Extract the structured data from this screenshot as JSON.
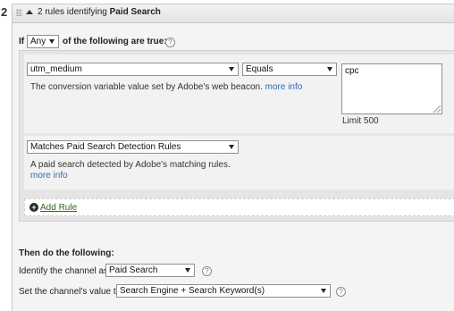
{
  "rule": {
    "number": "2",
    "title_prefix": "2 rules identifying ",
    "title_bold": "Paid Search"
  },
  "conditions": {
    "if_label": "If",
    "match_select": "Any",
    "of_following": "of the following are true:"
  },
  "rules": [
    {
      "variable_select": "utm_medium",
      "operator_select": "Equals",
      "value_text": "cpc",
      "limit_text": "Limit 500",
      "description": "The conversion variable value set by Adobe's web beacon.",
      "more_info": "more info"
    },
    {
      "variable_select": "Matches Paid Search Detection Rules",
      "description": "A paid search detected by Adobe's matching rules.",
      "more_info": "more info"
    }
  ],
  "add_rule": {
    "label": "Add Rule"
  },
  "actions": {
    "title": "Then do the following:",
    "identify_label": "Identify the channel as",
    "identify_select": "Paid Search",
    "set_label": "Set the channel's value to",
    "set_select": "Search Engine + Search Keyword(s)"
  },
  "icons": {
    "help": "?",
    "plus": "+"
  }
}
